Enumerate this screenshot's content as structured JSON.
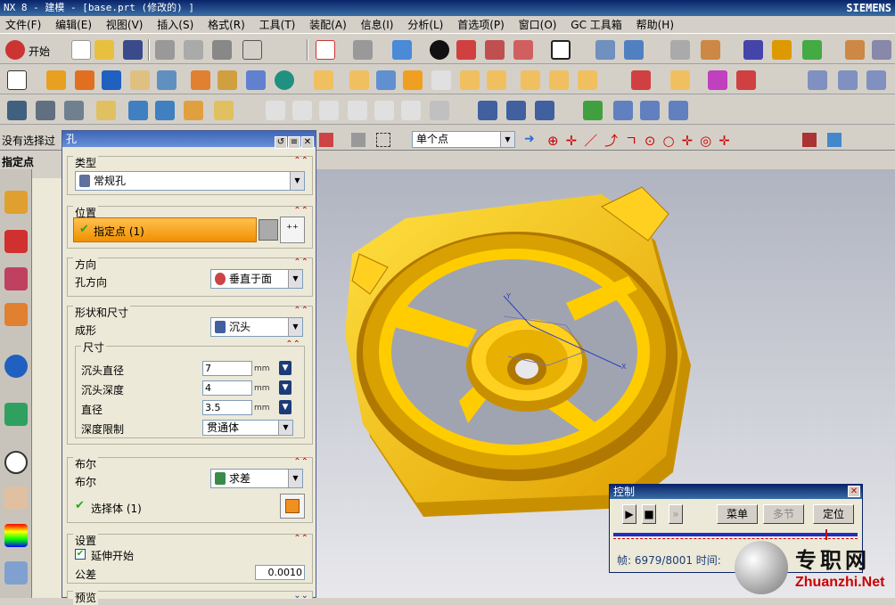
{
  "window": {
    "title": "NX 8 - 建模 - [base.prt (修改的) ]",
    "brand": "SIEMENS"
  },
  "menu": [
    "文件(F)",
    "编辑(E)",
    "视图(V)",
    "插入(S)",
    "格式(R)",
    "工具(T)",
    "装配(A)",
    "信息(I)",
    "分析(L)",
    "首选项(P)",
    "窗口(O)",
    "GC 工具箱",
    "帮助(H)"
  ],
  "toolbar": {
    "start_label": "开始"
  },
  "selection": {
    "status": "没有选择过",
    "filter": "单个点"
  },
  "prompt": "指定点",
  "dialog": {
    "title": "孔",
    "type_group": {
      "header": "类型",
      "value": "常规孔"
    },
    "position_group": {
      "header": "位置",
      "point_label": "指定点 (1)"
    },
    "direction_group": {
      "header": "方向",
      "label": "孔方向",
      "value": "垂直于面"
    },
    "shape_group": {
      "header": "形状和尺寸",
      "form_label": "成形",
      "form_value": "沉头",
      "dims_header": "尺寸",
      "rows": [
        {
          "label": "沉头直径",
          "value": "7",
          "unit": "mm"
        },
        {
          "label": "沉头深度",
          "value": "4",
          "unit": "mm"
        },
        {
          "label": "直径",
          "value": "3.5",
          "unit": "mm"
        }
      ],
      "depth_limit_label": "深度限制",
      "depth_limit_value": "贯通体"
    },
    "boolean_group": {
      "header": "布尔",
      "label": "布尔",
      "value": "求差",
      "select_body": "选择体 (1)"
    },
    "settings_group": {
      "header": "设置",
      "extend_start": "延伸开始",
      "tolerance_label": "公差",
      "tolerance_value": "0.0010"
    },
    "preview_group": {
      "header": "预览"
    }
  },
  "control": {
    "title": "控制",
    "menu_btn": "菜单",
    "step_btn": "多节",
    "locate_btn": "定位",
    "frame_text": "帧: 6979/8001 时间:",
    "progress": 0.87
  },
  "watermark": {
    "cn": "专职网",
    "en": "Zhuanzhi.Net"
  }
}
